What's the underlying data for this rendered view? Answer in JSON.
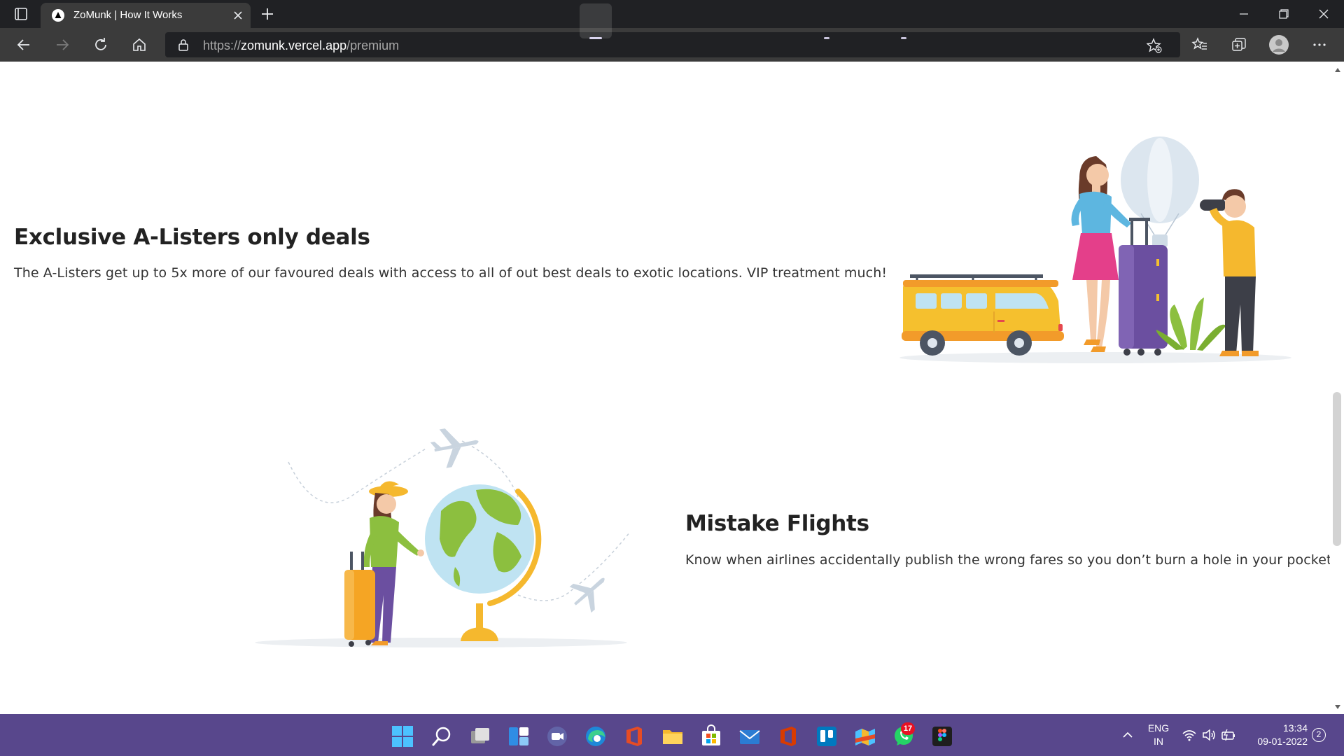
{
  "browser": {
    "tab_title": "ZoMunk | How It Works",
    "url_scheme": "https://",
    "url_host": "zomunk.vercel.app",
    "url_path": "/premium"
  },
  "sections": [
    {
      "title": "Exclusive A-Listers only deals",
      "description": "The A-Listers get up to 5x more of our favoured deals with access to all of out best deals to exotic locations. VIP treatment much!"
    },
    {
      "title": "Mistake Flights",
      "description": "Know when airlines accidentally publish the wrong fares so you don’t burn a hole in your pocket."
    }
  ],
  "taskbar": {
    "whatsapp_badge": "17",
    "language": "ENG",
    "region": "IN",
    "time": "13:34",
    "date": "09-01-2022",
    "notifications": "2"
  },
  "colors": {
    "taskbar": "#58478c",
    "van": "#f5c02e",
    "suitcase_purple": "#6b4fa0",
    "globe_land": "#8cbf3f"
  }
}
